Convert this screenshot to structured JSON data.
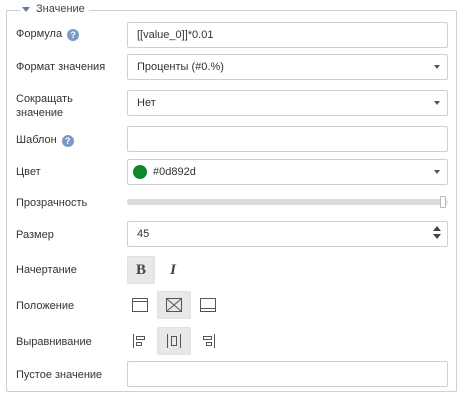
{
  "section": {
    "title": "Значение"
  },
  "formula": {
    "label": "Формула",
    "value": "[[value_0]]*0.01"
  },
  "value_format": {
    "label": "Формат значения",
    "value": "Проценты (#0.%)"
  },
  "shorten": {
    "label": "Сокращать значение",
    "value": "Нет"
  },
  "template": {
    "label": "Шаблон",
    "value": ""
  },
  "color": {
    "label": "Цвет",
    "value": "#0d892d",
    "swatch": "#0d892d"
  },
  "opacity": {
    "label": "Прозрачность",
    "level": 1.0
  },
  "size": {
    "label": "Размер",
    "value": "45"
  },
  "font_style": {
    "label": "Начертание",
    "bold": "B",
    "italic": "I",
    "bold_active": true,
    "italic_active": false
  },
  "position": {
    "label": "Положение",
    "options": [
      "top-position-icon",
      "center-position-icon",
      "bottom-position-icon"
    ],
    "selected": 1
  },
  "alignment": {
    "label": "Выравнивание",
    "options": [
      "align-left-icon",
      "align-center-icon",
      "align-right-icon"
    ],
    "selected": 1
  },
  "empty_value": {
    "label": "Пустое значение",
    "value": ""
  },
  "help_glyph": "?"
}
